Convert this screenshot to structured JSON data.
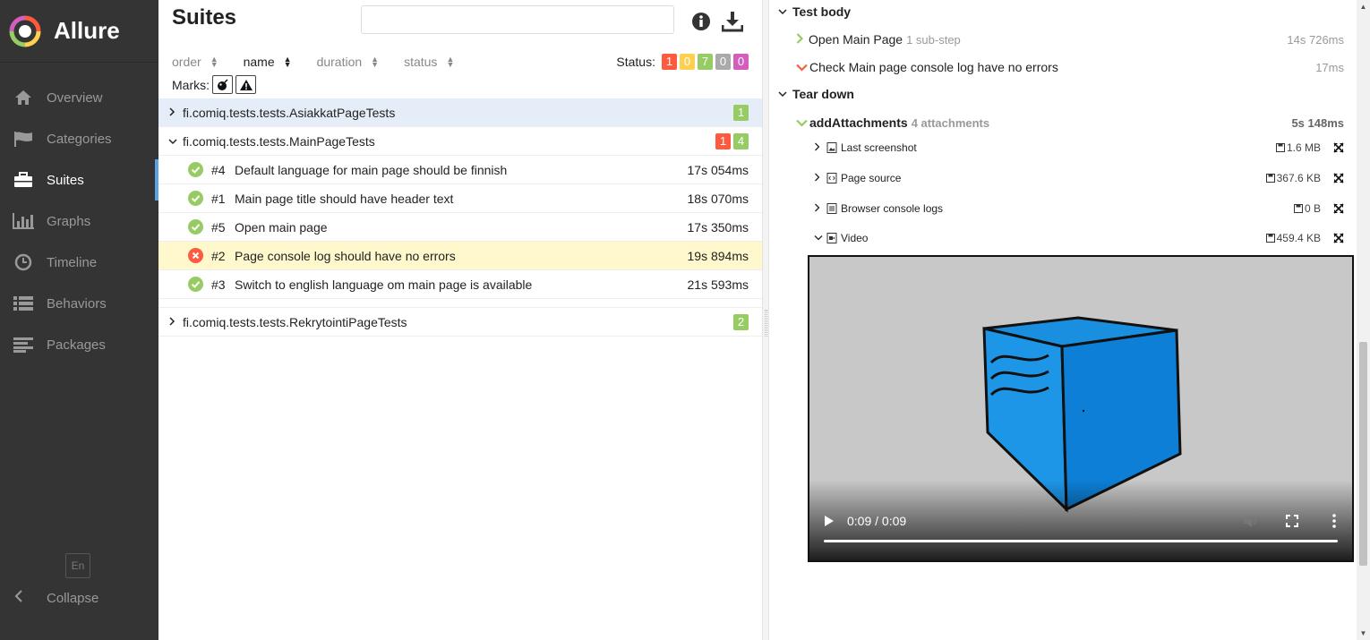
{
  "app": {
    "name": "Allure"
  },
  "sidebar": {
    "items": [
      {
        "label": "Overview",
        "icon": "home-icon"
      },
      {
        "label": "Categories",
        "icon": "flag-icon"
      },
      {
        "label": "Suites",
        "icon": "briefcase-icon",
        "active": true
      },
      {
        "label": "Graphs",
        "icon": "bar-chart-icon"
      },
      {
        "label": "Timeline",
        "icon": "clock-icon"
      },
      {
        "label": "Behaviors",
        "icon": "list-icon"
      },
      {
        "label": "Packages",
        "icon": "align-left-icon"
      }
    ],
    "language": "En",
    "collapse_label": "Collapse"
  },
  "suites": {
    "title": "Suites",
    "search_value": "",
    "sort": {
      "order": "order",
      "name": "name",
      "duration": "duration",
      "status": "status",
      "active": "name"
    },
    "status_label": "Status:",
    "status_counts": {
      "failed": "1",
      "broken": "0",
      "passed": "7",
      "skipped": "0",
      "unknown": "0"
    },
    "marks_label": "Marks:",
    "groups": [
      {
        "name": "fi.comiq.tests.tests.AsiakkatPageTests",
        "expanded": false,
        "badges": [
          {
            "status": "passed",
            "count": "1"
          }
        ]
      },
      {
        "name": "fi.comiq.tests.tests.MainPageTests",
        "expanded": true,
        "badges": [
          {
            "status": "failed",
            "count": "1"
          },
          {
            "status": "passed",
            "count": "4"
          }
        ],
        "tests": [
          {
            "order": "#4",
            "name": "Default language for main page should be finnish",
            "duration": "17s 054ms",
            "status": "passed"
          },
          {
            "order": "#1",
            "name": "Main page title should have header text",
            "duration": "18s 070ms",
            "status": "passed"
          },
          {
            "order": "#5",
            "name": "Open main page",
            "duration": "17s 350ms",
            "status": "passed"
          },
          {
            "order": "#2",
            "name": "Page console log should have no errors",
            "duration": "19s 894ms",
            "status": "failed"
          },
          {
            "order": "#3",
            "name": "Switch to english language om main page is available",
            "duration": "21s 593ms",
            "status": "passed"
          }
        ]
      },
      {
        "name": "fi.comiq.tests.tests.RekrytointiPageTests",
        "expanded": false,
        "badges": [
          {
            "status": "passed",
            "count": "2"
          }
        ]
      }
    ]
  },
  "details": {
    "test_body_label": "Test body",
    "steps": [
      {
        "name": "Open Main Page",
        "sub": "1 sub-step",
        "duration": "14s 726ms",
        "status": "passed"
      },
      {
        "name": "Check Main page console log have no errors",
        "sub": "",
        "duration": "17ms",
        "status": "failed"
      }
    ],
    "tear_down_label": "Tear down",
    "teardown_step": {
      "name": "addAttachments",
      "sub": "4 attachments",
      "duration": "5s 148ms"
    },
    "attachments": [
      {
        "name": "Last screenshot",
        "size": "1.6 MB",
        "icon": "image-file-icon",
        "expanded": false
      },
      {
        "name": "Page source",
        "size": "367.6 KB",
        "icon": "code-file-icon",
        "expanded": false
      },
      {
        "name": "Browser console logs",
        "size": "0 B",
        "icon": "text-file-icon",
        "expanded": false
      },
      {
        "name": "Video",
        "size": "459.4 KB",
        "icon": "video-file-icon",
        "expanded": true
      }
    ],
    "video": {
      "time": "0:09 / 0:09",
      "progress": 1.0
    }
  },
  "colors": {
    "failed": "#fd5a3e",
    "broken": "#ffd050",
    "passed": "#97cc64",
    "skipped": "#aaaaaa",
    "unknown": "#d35ebe",
    "sidebar_bg": "#343434",
    "accent": "#5aa2e8",
    "selected_row": "#fff8cc",
    "hover_row": "#e4edf8"
  }
}
